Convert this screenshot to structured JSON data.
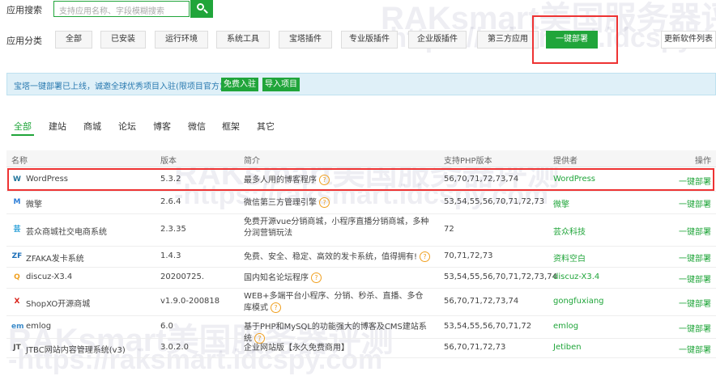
{
  "search": {
    "label": "应用搜索",
    "placeholder": "支持应用名称、字段模糊搜索"
  },
  "categories": {
    "label": "应用分类",
    "items": [
      "全部",
      "已安装",
      "运行环境",
      "系统工具",
      "宝塔插件",
      "专业版插件",
      "企业版插件",
      "第三方应用",
      "一键部署"
    ],
    "active": "一键部署",
    "refresh": "更新软件列表"
  },
  "banner": {
    "text": "宝塔一键部署已上线，诚邀全球优秀项目入驻(限项目官方)",
    "btn_free": "免费入驻",
    "btn_import": "导入项目"
  },
  "tabs": [
    "全部",
    "建站",
    "商城",
    "论坛",
    "博客",
    "微信",
    "框架",
    "其它"
  ],
  "table": {
    "headers": {
      "name": "名称",
      "version": "版本",
      "desc": "简介",
      "php": "支持PHP版本",
      "provider": "提供者",
      "op": "操作"
    },
    "rows": [
      {
        "name": "WordPress",
        "version": "5.3.2",
        "desc": "最多人用的博客程序",
        "php": "56,70,71,72,73,74",
        "provider": "WordPress",
        "op": "一键部署",
        "icon": "wordpress-icon",
        "ichar": "W",
        "icolor": "#21759b"
      },
      {
        "name": "微擎",
        "version": "2.6.4",
        "desc": "微信第三方管理引擎",
        "php": "53,54,55,56,70,71,72,73",
        "provider": "微擎",
        "op": "一键部署",
        "icon": "weengine-icon",
        "ichar": "M",
        "icolor": "#2d7ed8"
      },
      {
        "name": "芸众商城社交电商系统",
        "version": "2.3.35",
        "desc": "免费开源vue分销商城，小程序直播分销商城，多种分润营销玩法",
        "php": "72",
        "provider": "芸众科技",
        "op": "一键部署",
        "icon": "yunzhong-icon",
        "ichar": "芸",
        "icolor": "#2aa0d8"
      },
      {
        "name": "ZFAKA发卡系统",
        "version": "1.4.3",
        "desc": "免费、安全、稳定、高效的发卡系统，值得拥有!",
        "php": "70,71,72,73",
        "provider": "资料空白",
        "op": "一键部署",
        "icon": "zfaka-icon",
        "ichar": "ZF",
        "icolor": "#1c6fb8"
      },
      {
        "name": "discuz-X3.4",
        "version": "20200725.",
        "desc": "国内知名论坛程序",
        "php": "53,54,55,56,70,71,72,73,74",
        "provider": "discuz-X3.4",
        "op": "一键部署",
        "icon": "discuz-icon",
        "ichar": "Q",
        "icolor": "#f0a020"
      },
      {
        "name": "ShopXO开源商城",
        "version": "v1.9.0-200818",
        "desc": "WEB+多端平台小程序、分销、秒杀、直播、多仓库模式",
        "php": "56,70,71,72,73,74",
        "provider": "gongfuxiang",
        "op": "一键部署",
        "icon": "shopxo-icon",
        "ichar": "X",
        "icolor": "#d9231a"
      },
      {
        "name": "emlog",
        "version": "6.0",
        "desc": "基于PHP和MySQL的功能强大的博客及CMS建站系统",
        "php": "53,54,55,56,70,71,72",
        "provider": "emlog",
        "op": "一键部署",
        "icon": "emlog-icon",
        "ichar": "em",
        "icolor": "#3a8ac9"
      },
      {
        "name": "JTBC网站内容管理系统(v3)",
        "version": "3.0.2.0",
        "desc": "企业网站版【永久免费商用】",
        "php": "56,70,71,72,73",
        "provider": "Jetiben",
        "op": "一键部署",
        "icon": "jtbc-icon",
        "ichar": "JT",
        "icolor": "#555555"
      }
    ]
  },
  "watermark": {
    "brand": "RAKsmart美国服务器评测",
    "url": "-https://raksmart.idcspy.com"
  }
}
